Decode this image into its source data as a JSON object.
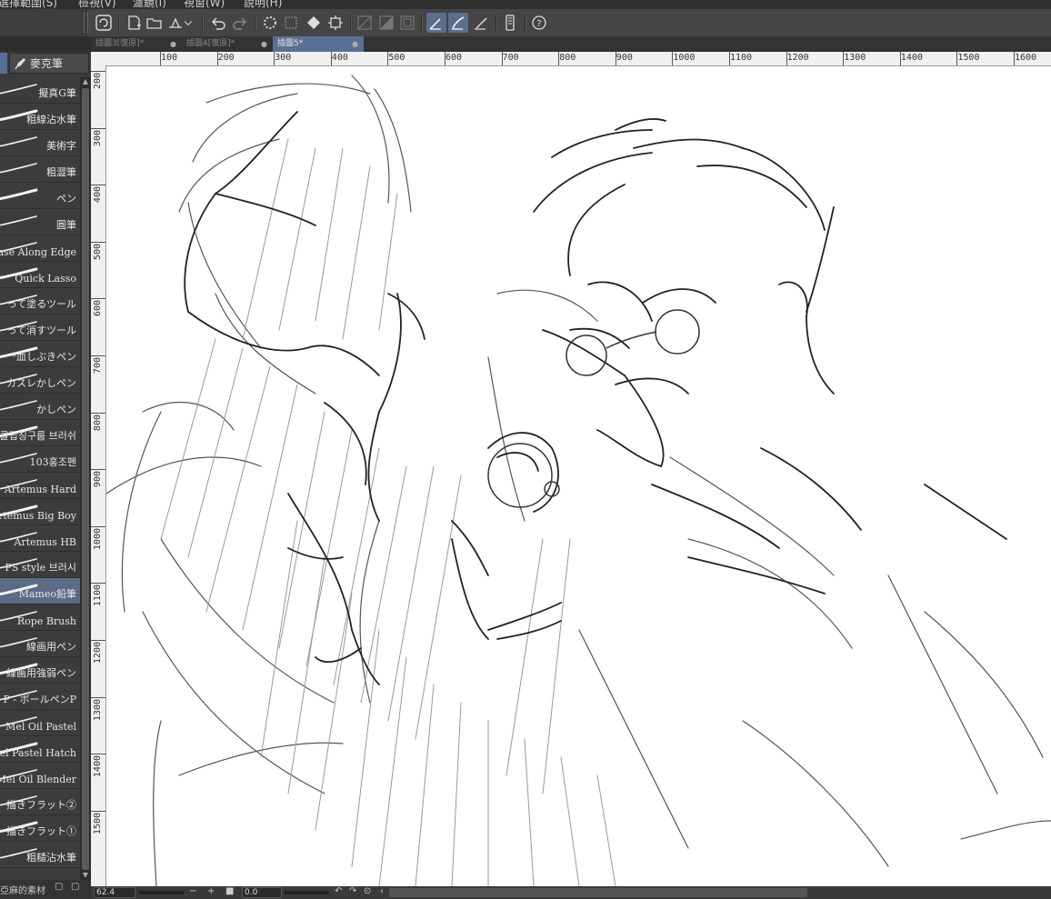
{
  "menu": [
    "選擇範圍(S)",
    "檢視(V)",
    "濾鏡(I)",
    "視窗(W)",
    "說明(H)"
  ],
  "tabs": [
    {
      "label": "插圖3[復原]*",
      "dot": "●"
    },
    {
      "label": "插圖4[復原]*",
      "dot": "●"
    },
    {
      "label": "插圖5*",
      "dot": "●"
    }
  ],
  "subtool": {
    "group_label": "麥克筆"
  },
  "brushes": [
    "擬真G筆",
    "粗線沾水筆",
    "美術字",
    "粗澀筆",
    "ペン",
    "圓筆",
    "Erase Along Edge",
    "Quick Lasso",
    "って塗るツール",
    "って消すツール",
    "*血しぶきペン",
    "カスレかしペン",
    "かしペン",
    "] 클립칭구룹 브러쉬",
    "103홍조펜",
    "Artemus Hard",
    "Artemus Big Boy",
    "Artemus HB",
    "PS style 브러시",
    "Mameo鉛筆",
    "Rope Brush",
    "線画用ペン",
    "線画用強弱ペン",
    "P - ボールペンP",
    "Mel Oil Pastel",
    "Mel Pastel Hatch",
    "Mel Oil Blender",
    "描きフラット②",
    "描きフラット①",
    "粗糙沾水筆"
  ],
  "selected_brush": "Mameo鉛筆",
  "ruler": {
    "h_ticks": [
      "100",
      "200",
      "300",
      "400",
      "500",
      "600",
      "700",
      "800",
      "900",
      "1000",
      "1100",
      "1200",
      "1300",
      "1400",
      "1500",
      "1600"
    ],
    "v_ticks": [
      "200",
      "300",
      "400",
      "500",
      "600",
      "700",
      "800",
      "900",
      "1000",
      "1100",
      "1200",
      "1300",
      "1400",
      "1500"
    ]
  },
  "status": {
    "zoom": "62.4",
    "angle": "0.0"
  },
  "bottom_left": "亞麻的素材",
  "colors": {
    "accent": "#5b6f95",
    "panel": "#3c3c3c",
    "canvas": "#ffffff"
  },
  "icons": [
    "logo-icon",
    "new-file-icon",
    "open-file-icon",
    "save-icon",
    "undo-icon",
    "redo-icon",
    "loading-icon",
    "clear-icon",
    "fill-icon",
    "transform-icon",
    "snap-ruler-icon",
    "snap-special-icon",
    "snap-grid-icon",
    "pen-pressure-icon",
    "brush-stabilizer-icon",
    "brush-edge-icon",
    "device-icon",
    "help-icon"
  ]
}
